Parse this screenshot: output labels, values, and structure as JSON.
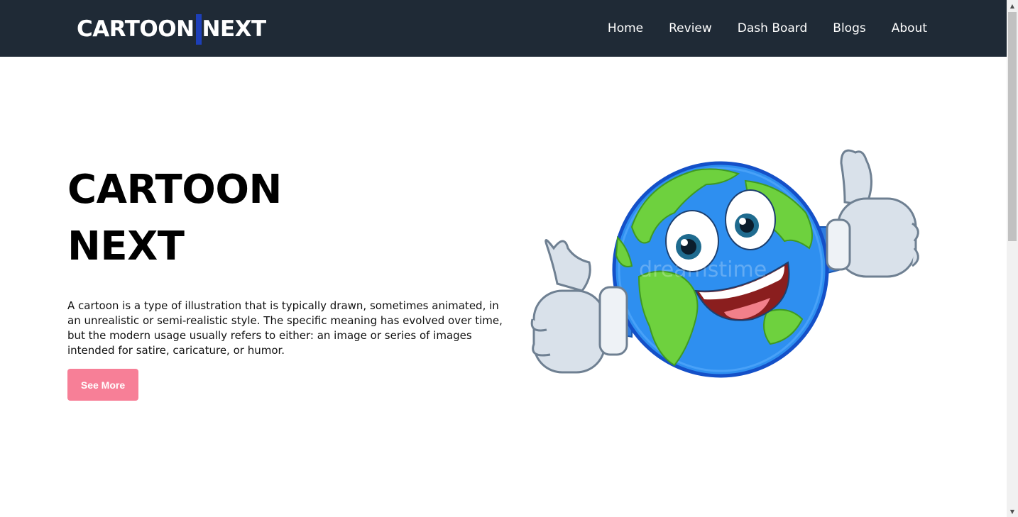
{
  "navbar": {
    "brand_left": "CARTOON",
    "brand_right": "NEXT",
    "brand_accent_color": "#1d3fb8",
    "background_color": "#1f2a36",
    "links": [
      "Home",
      "Review",
      "Dash Board",
      "Blogs",
      "About"
    ]
  },
  "hero": {
    "title_line1": "CARTOON",
    "title_line2": "NEXT",
    "description": "A cartoon is a type of illustration that is typically drawn, sometimes animated, in an unrealistic or semi-realistic style. The specific meaning has evolved over time, but the modern usage usually refers to either: an image or series of images intended for satire, caricature, or humor.",
    "button_label": "See More",
    "button_color": "#f77f97"
  },
  "illustration": {
    "subject": "cartoon-earth-globe-thumbs-up",
    "watermark": "dreamstime"
  },
  "scrollbar": {
    "up_icon": "triangle-up-icon",
    "down_icon": "triangle-down-icon"
  }
}
